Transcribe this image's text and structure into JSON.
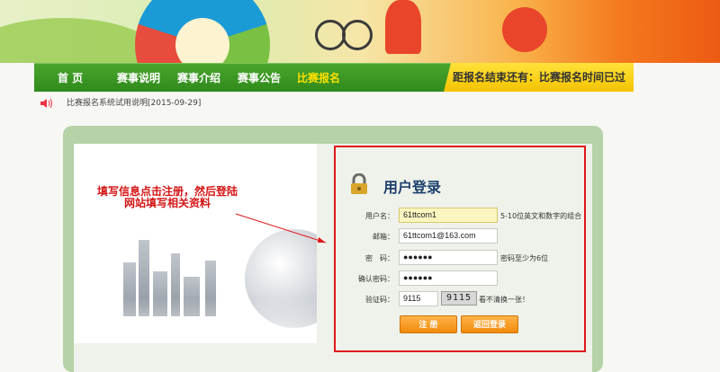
{
  "nav": {
    "items": [
      {
        "label": "首 页"
      },
      {
        "label": "赛事说明"
      },
      {
        "label": "赛事介绍"
      },
      {
        "label": "赛事公告"
      },
      {
        "label": "比赛报名"
      }
    ],
    "countdown": "距报名结束还有：比赛报名时间已过"
  },
  "news": {
    "text": "比赛报名系统试用说明[2015-09-29]"
  },
  "callout": {
    "text": "填写信息点击注册，然后登陆网站填写相关资料"
  },
  "login": {
    "title": "用户登录",
    "fields": [
      {
        "label": "用户名：",
        "value": "61ttcom1",
        "hint": "5-10位英文和数字的组合"
      },
      {
        "label": "邮箱：",
        "value": "61ttcom1@163.com",
        "hint": ""
      },
      {
        "label": "密　码：",
        "value": "●●●●●●",
        "hint": "密码至少为6位"
      },
      {
        "label": "确认密码：",
        "value": "●●●●●●",
        "hint": ""
      },
      {
        "label": "验证码：",
        "value": "9115",
        "hint": "看不清换一张！"
      }
    ],
    "captcha_text": "9115",
    "register_label": "注 册",
    "back_label": "返回登录"
  },
  "colors": {
    "nav_green": "#3a9a26",
    "active_nav": "#ffe000",
    "annotation_red": "#e0171b",
    "button_orange": "#f08a0c"
  },
  "icons": [
    "speaker-icon",
    "lock-icon",
    "arrow-icon"
  ]
}
